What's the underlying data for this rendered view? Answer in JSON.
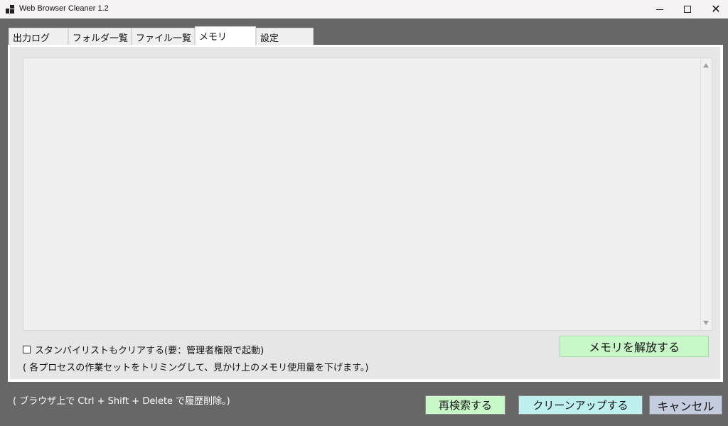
{
  "window": {
    "title": "Web Browser Cleaner 1.2",
    "minimize_icon": "minimize-icon",
    "maximize_icon": "maximize-icon",
    "close_icon": "close-icon",
    "close_glyph": "✕"
  },
  "tabs": [
    {
      "label": "出力ログ",
      "active": false
    },
    {
      "label": "フォルダ一覧",
      "active": false
    },
    {
      "label": "ファイル一覧",
      "active": false
    },
    {
      "label": "メモリ",
      "active": true
    },
    {
      "label": "設定",
      "active": false
    }
  ],
  "memory_panel": {
    "output_text": "",
    "standby_checkbox": {
      "label": "スタンバイリストもクリアする(要：管理者権限で起動)",
      "checked": false
    },
    "note": "( 各プロセスの作業セットをトリミングして、見かけ上のメモリ使用量を下げます。)",
    "release_button": "メモリを解放する"
  },
  "footer": {
    "hint": "( ブラウザ上で Ctrl + Shift + Delete で履歴削除。)",
    "research_button": "再検索する",
    "cleanup_button": "クリーンアップする",
    "cancel_button": "キャンセル"
  },
  "colors": {
    "background": "#676767",
    "release_button": "#c8f8c8",
    "research_button": "#c8f8c8",
    "cleanup_button": "#bff0f0",
    "cancel_button": "#c4cce0"
  }
}
